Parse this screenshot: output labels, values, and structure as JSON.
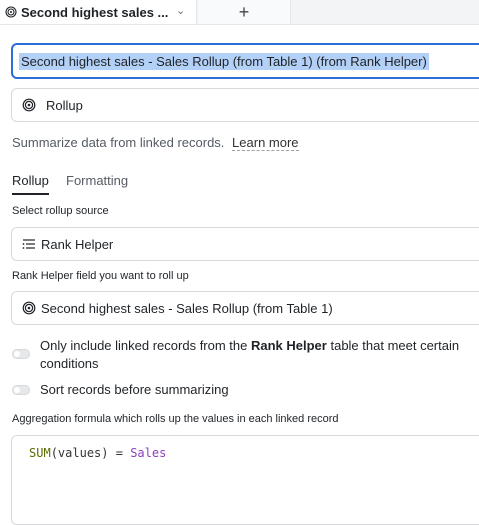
{
  "tab": {
    "title": "Second highest sales ...",
    "add_label": "+"
  },
  "field_name": "Second highest sales - Sales Rollup (from Table 1) (from Rank Helper)",
  "field_type": {
    "label": "Rollup",
    "icon": "rollup-icon"
  },
  "description": {
    "text": "Summarize data from linked records.",
    "link": "Learn more"
  },
  "config_tabs": {
    "rollup": "Rollup",
    "formatting": "Formatting"
  },
  "source": {
    "label": "Select rollup source",
    "value": "Rank Helper",
    "icon": "list-icon"
  },
  "rollup_field": {
    "label_bold": "Rank Helper",
    "label_rest": " field you want to roll up",
    "value": "Second highest sales - Sales Rollup (from Table 1)",
    "icon": "rollup-icon"
  },
  "filter_toggle": {
    "text_before": "Only include linked records from the ",
    "text_bold": "Rank Helper",
    "text_after": " table that meet certain conditions",
    "enabled": false
  },
  "sort_toggle": {
    "text": "Sort records before summarizing",
    "enabled": false
  },
  "formula": {
    "label": "Aggregation formula which rolls up the values in each linked record",
    "fn": "SUM",
    "open_paren": "(",
    "arg": "values",
    "close_paren": ")",
    "op": " = ",
    "field": "Sales"
  },
  "colors": {
    "accent": "#2b6fd6",
    "selection": "#b3d0f6",
    "formula_function": "#5c6b00",
    "formula_field": "#8b3fbf"
  }
}
